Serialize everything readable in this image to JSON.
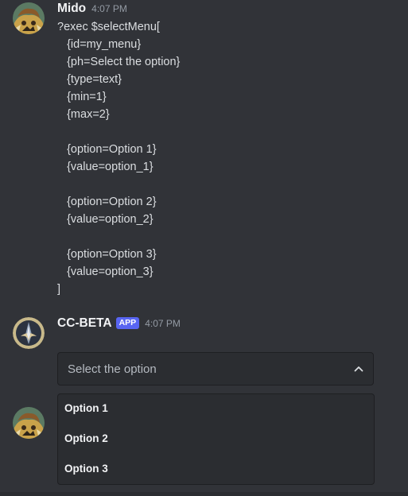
{
  "messages": [
    {
      "username": "Mido",
      "timestamp": "4:07 PM",
      "avatar_icon": "anime-character-avatar",
      "lines": [
        "?exec $selectMenu[",
        "   {id=my_menu}",
        "   {ph=Select the option}",
        "   {type=text}",
        "   {min=1}",
        "   {max=2}",
        "",
        "   {option=Option 1}",
        "   {value=option_1}",
        "",
        "   {option=Option 2}",
        "   {value=option_2}",
        "",
        "   {option=Option 3}",
        "   {value=option_3}",
        "]"
      ]
    },
    {
      "username": "CC-BETA",
      "badge": "APP",
      "timestamp": "4:07 PM",
      "avatar_icon": "bot-logo-avatar",
      "select_menu": {
        "placeholder": "Select the option",
        "expanded": true,
        "chevron_icon": "chevron-up-icon",
        "options": [
          "Option 1",
          "Option 2",
          "Option 3"
        ]
      }
    }
  ],
  "colors": {
    "background": "#313338",
    "badge": "#5865f2",
    "select_bg": "#2b2d31",
    "text": "#dbdee1",
    "muted": "#949ba4"
  }
}
